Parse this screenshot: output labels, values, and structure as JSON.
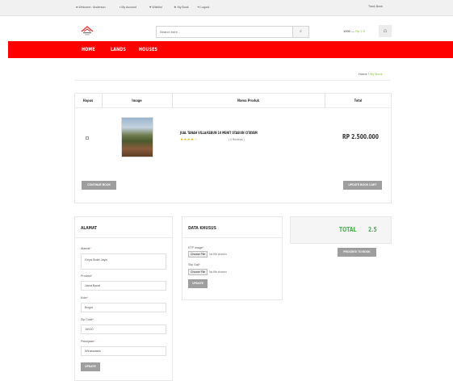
{
  "topbar": {
    "welcome": "Welcome : Anderson",
    "my_account": "My Account",
    "wishlist": "Wishlist",
    "my_book": "My Book",
    "logout": "Logout",
    "track_book": "Track Book"
  },
  "header": {
    "search_placeholder": "Search here...",
    "cart_count": "1000",
    "cart_price": "Rp 2.5"
  },
  "nav": {
    "items": [
      {
        "label": "HOME"
      },
      {
        "label": "LANDS"
      },
      {
        "label": "HOUSES"
      }
    ]
  },
  "breadcrumb": {
    "home": "Home",
    "separator": "/",
    "current": "My Book"
  },
  "cart_table": {
    "headers": [
      "Hapus",
      "Image",
      "Nama Produk",
      "Total"
    ],
    "rows": [
      {
        "name": "JUAL TANAH VILLA/KEBUN 10 MENIT STASIUN CITAYAM",
        "stars": "★★★★☆",
        "reviews": "( 0 Reviews )",
        "total": "RP 2.500.000"
      }
    ],
    "continue_label": "CONTINUE BOOK",
    "update_cart_label": "UPDATE BOOK CART"
  },
  "alamat": {
    "title": "ALAMAT",
    "fields": [
      {
        "label": "Alamat",
        "value": "Griya Bukit Jaya"
      },
      {
        "label": "Provinsi",
        "value": "Jawa Barat"
      },
      {
        "label": "Kota",
        "value": "Bogor"
      },
      {
        "label": "Zip Code",
        "value": "16920"
      },
      {
        "label": "Pekerjaan",
        "value": "Wiraswasta"
      }
    ],
    "update_label": "UPDATE"
  },
  "data_khusus": {
    "title": "DATA KHUSUS",
    "fields": [
      {
        "label": "KTP Image",
        "button": "Choose File",
        "status": "No file chosen"
      },
      {
        "label": "Slip Gaji",
        "button": "Choose File",
        "status": "No file chosen"
      }
    ],
    "update_label": "UPDATE"
  },
  "summary": {
    "total_label": "TOTAL",
    "total_value": "2.5",
    "proceed_label": "PROCEED TO BOOK"
  },
  "colors": {
    "nav_red": "#ff0000",
    "accent_green": "#4caf50",
    "button_gray": "#9e9e9e"
  },
  "icons": [
    "user-icon",
    "lock-icon",
    "heart-icon",
    "star-icon",
    "logout-icon",
    "search-icon",
    "home-icon",
    "logo-icon"
  ]
}
